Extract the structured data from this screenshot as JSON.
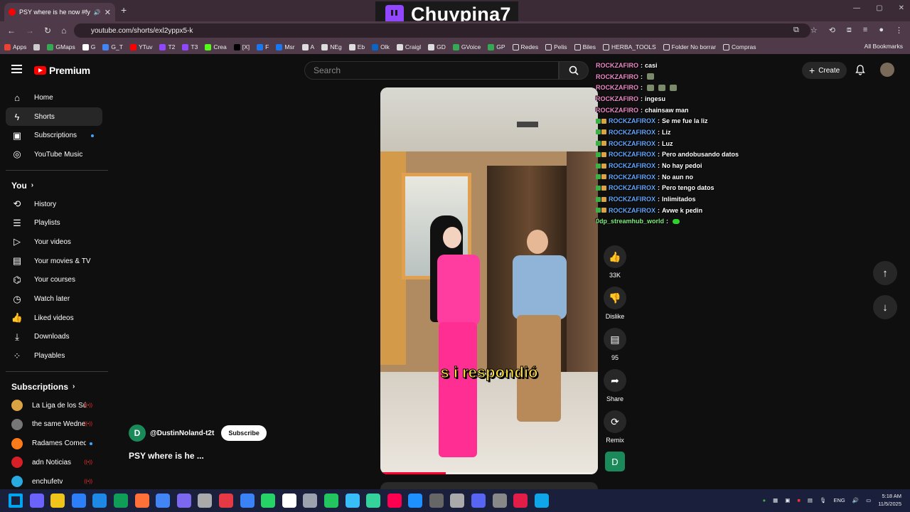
{
  "browser": {
    "tab_title": "PSY where is he now #fyp",
    "url": "youtube.com/shorts/exl2yppx5-k",
    "bookmarks": [
      "Apps",
      "GMaps",
      "G",
      "G_T",
      "YTuv",
      "T2",
      "T3",
      "Crea",
      "[X]",
      "F",
      "Msr",
      "A",
      "NEg",
      "Eb",
      "Olk",
      "Craigl",
      "GD",
      "GVoice",
      "GP",
      "Redes",
      "Pelis",
      "Biles",
      "HERBA_TOOLS",
      "Folder No borrar",
      "Compras"
    ],
    "all_bookmarks": "All Bookmarks"
  },
  "streamer": {
    "name": "Chuypina7"
  },
  "youtube": {
    "logo_text": "Premium",
    "search_placeholder": "Search",
    "create_label": "Create"
  },
  "sidebar": {
    "main": [
      {
        "label": "Home",
        "icon": "home-icon"
      },
      {
        "label": "Shorts",
        "icon": "shorts-icon",
        "active": true
      },
      {
        "label": "Subscriptions",
        "icon": "subscriptions-icon",
        "new": true
      },
      {
        "label": "YouTube Music",
        "icon": "music-icon"
      }
    ],
    "you_header": "You",
    "you": [
      {
        "label": "History",
        "icon": "history-icon"
      },
      {
        "label": "Playlists",
        "icon": "playlists-icon"
      },
      {
        "label": "Your videos",
        "icon": "your-videos-icon"
      },
      {
        "label": "Your movies & TV",
        "icon": "movies-icon"
      },
      {
        "label": "Your courses",
        "icon": "courses-icon"
      },
      {
        "label": "Watch later",
        "icon": "clock-icon"
      },
      {
        "label": "Liked videos",
        "icon": "like-icon"
      },
      {
        "label": "Downloads",
        "icon": "download-icon"
      },
      {
        "label": "Playables",
        "icon": "playables-icon"
      }
    ],
    "subs_header": "Subscriptions",
    "subs": [
      {
        "label": "La Liga de los Sú...",
        "live": true,
        "color": "#d9a441"
      },
      {
        "label": "the same Wedne...",
        "live": true,
        "color": "#777777"
      },
      {
        "label": "Radames Comedy",
        "new": true,
        "color": "#ff7a1a"
      },
      {
        "label": "adn Noticias",
        "live": true,
        "color": "#d61f26"
      },
      {
        "label": "enchufetv",
        "live": true,
        "color": "#28a9e0"
      }
    ]
  },
  "short": {
    "caption": "s i respondió",
    "channel_initial": "D",
    "channel_handle": "@DustinNoland-t2t",
    "subscribe_label": "Subscribe",
    "title": "PSY where is he ...",
    "likes": "33K",
    "dislike_label": "Dislike",
    "comments": "95",
    "share_label": "Share",
    "remix_label": "Remix"
  },
  "chat": [
    {
      "user": "ROCKZAFIRO",
      "msg": "casi",
      "color": "#f08ac8",
      "badges": false
    },
    {
      "user": "ROCKZAFIRO",
      "msg": "",
      "color": "#f08ac8",
      "badges": false,
      "emotes": 1
    },
    {
      "user": "ROCKZAFIRO",
      "msg": "",
      "color": "#f08ac8",
      "badges": false,
      "emotes": 3
    },
    {
      "user": "ROCKZAFIRO",
      "msg": "ingesu",
      "color": "#f08ac8",
      "badges": false
    },
    {
      "user": "ROCKZAFIRO",
      "msg": "chainsaw man",
      "color": "#f08ac8",
      "badges": false
    },
    {
      "user": "ROCKZAFIROX",
      "msg": "Se me fue la liz",
      "color": "#5fa8ff",
      "badges": true
    },
    {
      "user": "ROCKZAFIROX",
      "msg": "Liz",
      "color": "#5fa8ff",
      "badges": true
    },
    {
      "user": "ROCKZAFIROX",
      "msg": "Luz",
      "color": "#5fa8ff",
      "badges": true
    },
    {
      "user": "ROCKZAFIROX",
      "msg": "Pero andobusando datos",
      "color": "#5fa8ff",
      "badges": true
    },
    {
      "user": "ROCKZAFIROX",
      "msg": "No hay pedoi",
      "color": "#5fa8ff",
      "badges": true
    },
    {
      "user": "ROCKZAFIROX",
      "msg": "No aun no",
      "color": "#5fa8ff",
      "badges": true
    },
    {
      "user": "ROCKZAFIROX",
      "msg": "Pero tengo datos",
      "color": "#5fa8ff",
      "badges": true
    },
    {
      "user": "ROCKZAFIROX",
      "msg": "Inlimitados",
      "color": "#5fa8ff",
      "badges": true
    },
    {
      "user": "ROCKZAFIROX",
      "msg": "Avwe k pedin",
      "color": "#5fa8ff",
      "badges": true
    },
    {
      "user": "0dp_streamhub_world",
      "msg": "",
      "color": "#7cf07c",
      "badges": false,
      "blob": true
    }
  ],
  "taskbar": {
    "lang": "ENG",
    "time": "5:18 AM",
    "date": "11/5/2025"
  }
}
